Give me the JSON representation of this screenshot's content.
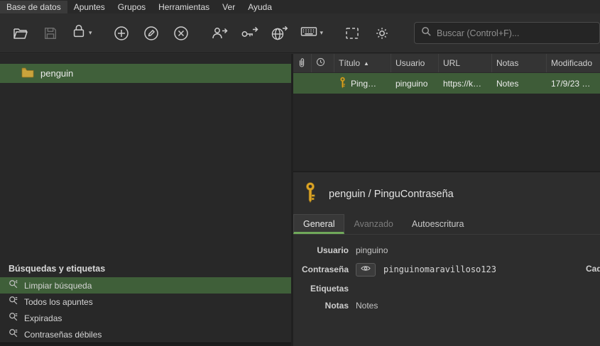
{
  "menubar": {
    "items": [
      "Base de datos",
      "Apuntes",
      "Grupos",
      "Herramientas",
      "Ver",
      "Ayuda"
    ]
  },
  "toolbar": {
    "search_placeholder": "Buscar (Control+F)..."
  },
  "sidebar": {
    "group": {
      "label": "penguin"
    },
    "searches": {
      "header": "Búsquedas y etiquetas",
      "items": [
        {
          "label": "Limpiar búsqueda",
          "selected": true
        },
        {
          "label": "Todos los apuntes",
          "selected": false
        },
        {
          "label": "Expiradas",
          "selected": false
        },
        {
          "label": "Contraseñas débiles",
          "selected": false
        }
      ]
    }
  },
  "entry_table": {
    "columns": {
      "title": "Título",
      "user": "Usuario",
      "url": "URL",
      "notes": "Notas",
      "modified": "Modificado"
    },
    "sort_column": "Título",
    "rows": [
      {
        "title": "Ping…",
        "user": "pinguino",
        "url": "https://k…",
        "notes": "Notes",
        "modified": "17/9/23 …"
      }
    ]
  },
  "preview": {
    "title": "penguin / PinguContraseña",
    "tabs": [
      "General",
      "Avanzado",
      "Autoescritura"
    ],
    "active_tab": "General",
    "fields": {
      "user_label": "Usuario",
      "user_value": "pinguino",
      "password_label": "Contraseña",
      "password_value": "pinguinomaravilloso123",
      "tags_label": "Etiquetas",
      "notes_label": "Notas",
      "notes_value": "Notes",
      "expires_label": "Caduca"
    }
  },
  "colors": {
    "selection_green": "#3e5c38",
    "accent_green": "#70a95a",
    "key_yellow": "#d9a521",
    "folder_yellow": "#c9a33c"
  }
}
